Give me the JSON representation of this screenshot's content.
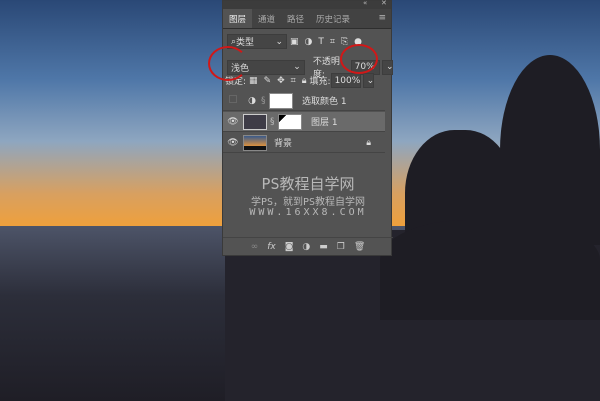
{
  "panel": {
    "tabs": [
      {
        "label": "图层",
        "active": true
      },
      {
        "label": "通道"
      },
      {
        "label": "路径"
      },
      {
        "label": "历史记录"
      }
    ],
    "filter": {
      "label": "类型",
      "icons": [
        "image-filter-icon",
        "adjustment-filter-icon",
        "type-filter-icon",
        "shape-filter-icon",
        "smart-object-filter-icon"
      ]
    },
    "blend_mode": "浅色",
    "opacity_label": "不透明度:",
    "opacity_value": "70%",
    "lock_label": "锁定:",
    "fill_label": "填充:",
    "fill_value": "100%",
    "layers": [
      {
        "name": "选取颜色 1",
        "visible": false,
        "type": "adjustment"
      },
      {
        "name": "图层 1",
        "visible": true,
        "selected": true
      },
      {
        "name": "背景",
        "visible": true,
        "locked": true
      }
    ],
    "bottom_icons": [
      "link-icon",
      "fx-icon",
      "mask-icon",
      "adjustment-icon",
      "folder-icon",
      "new-layer-icon",
      "trash-icon"
    ],
    "fx_label": "fx"
  },
  "watermark": {
    "line1": "PS教程自学网",
    "line2": "学PS，就到PS教程自学网",
    "line3": "WWW.16XX8.COM"
  },
  "colors": {
    "annotation": "#d01818",
    "selected_layer": "#6a6a6a"
  }
}
